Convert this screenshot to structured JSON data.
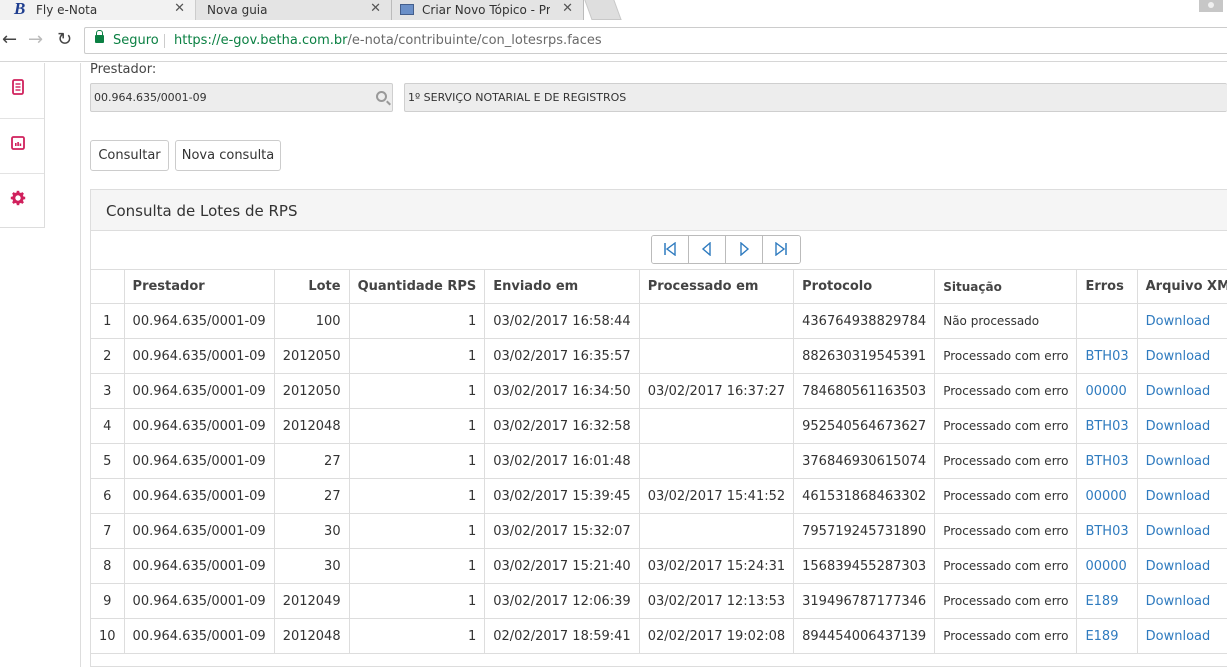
{
  "browser": {
    "tabs": [
      {
        "title": "Fly e-Nota",
        "favicon": "B"
      },
      {
        "title": "Nova guia"
      },
      {
        "title": "Criar Novo Tópico - Proje"
      }
    ],
    "secure_label": "Seguro",
    "url_host": "https://e-gov.betha.com.br",
    "url_path": "/e-nota/contribuinte/con_lotesrps.faces"
  },
  "sidebar": {
    "icons": [
      "document-icon",
      "calculator-icon",
      "gear-icon"
    ]
  },
  "form": {
    "prestador_label": "Prestador:",
    "cnpj_value": "00.964.635/0001-09",
    "razao_value": "1º SERVIÇO NOTARIAL E DE REGISTROS",
    "consultar_label": "Consultar",
    "nova_consulta_label": "Nova consulta"
  },
  "panel": {
    "title": "Consulta de Lotes de RPS"
  },
  "table": {
    "headers": [
      "",
      "Prestador",
      "Lote",
      "Quantidade RPS",
      "Enviado em",
      "Processado em",
      "Protocolo",
      "Situação",
      "Erros",
      "Arquivo XML"
    ],
    "rows": [
      [
        "1",
        "00.964.635/0001-09",
        "100",
        "1",
        "03/02/2017 16:58:44",
        "",
        "436764938829784",
        "Não processado",
        "",
        "Download"
      ],
      [
        "2",
        "00.964.635/0001-09",
        "2012050",
        "1",
        "03/02/2017 16:35:57",
        "",
        "882630319545391",
        "Processado com erro",
        "BTH03",
        "Download"
      ],
      [
        "3",
        "00.964.635/0001-09",
        "2012050",
        "1",
        "03/02/2017 16:34:50",
        "03/02/2017 16:37:27",
        "784680561163503",
        "Processado com erro",
        "00000",
        "Download"
      ],
      [
        "4",
        "00.964.635/0001-09",
        "2012048",
        "1",
        "03/02/2017 16:32:58",
        "",
        "952540564673627",
        "Processado com erro",
        "BTH03",
        "Download"
      ],
      [
        "5",
        "00.964.635/0001-09",
        "27",
        "1",
        "03/02/2017 16:01:48",
        "",
        "376846930615074",
        "Processado com erro",
        "BTH03",
        "Download"
      ],
      [
        "6",
        "00.964.635/0001-09",
        "27",
        "1",
        "03/02/2017 15:39:45",
        "03/02/2017 15:41:52",
        "461531868463302",
        "Processado com erro",
        "00000",
        "Download"
      ],
      [
        "7",
        "00.964.635/0001-09",
        "30",
        "1",
        "03/02/2017 15:32:07",
        "",
        "795719245731890",
        "Processado com erro",
        "BTH03",
        "Download"
      ],
      [
        "8",
        "00.964.635/0001-09",
        "30",
        "1",
        "03/02/2017 15:21:40",
        "03/02/2017 15:24:31",
        "156839455287303",
        "Processado com erro",
        "00000",
        "Download"
      ],
      [
        "9",
        "00.964.635/0001-09",
        "2012049",
        "1",
        "03/02/2017 12:06:39",
        "03/02/2017 12:13:53",
        "319496787177346",
        "Processado com erro",
        "E189",
        "Download"
      ],
      [
        "10",
        "00.964.635/0001-09",
        "2012048",
        "1",
        "02/02/2017 18:59:41",
        "02/02/2017 19:02:08",
        "894454006437139",
        "Processado com erro",
        "E189",
        "Download"
      ]
    ]
  },
  "colors": {
    "accent": "#d0205c",
    "link": "#2f7bbf",
    "secure": "#0b8043"
  }
}
